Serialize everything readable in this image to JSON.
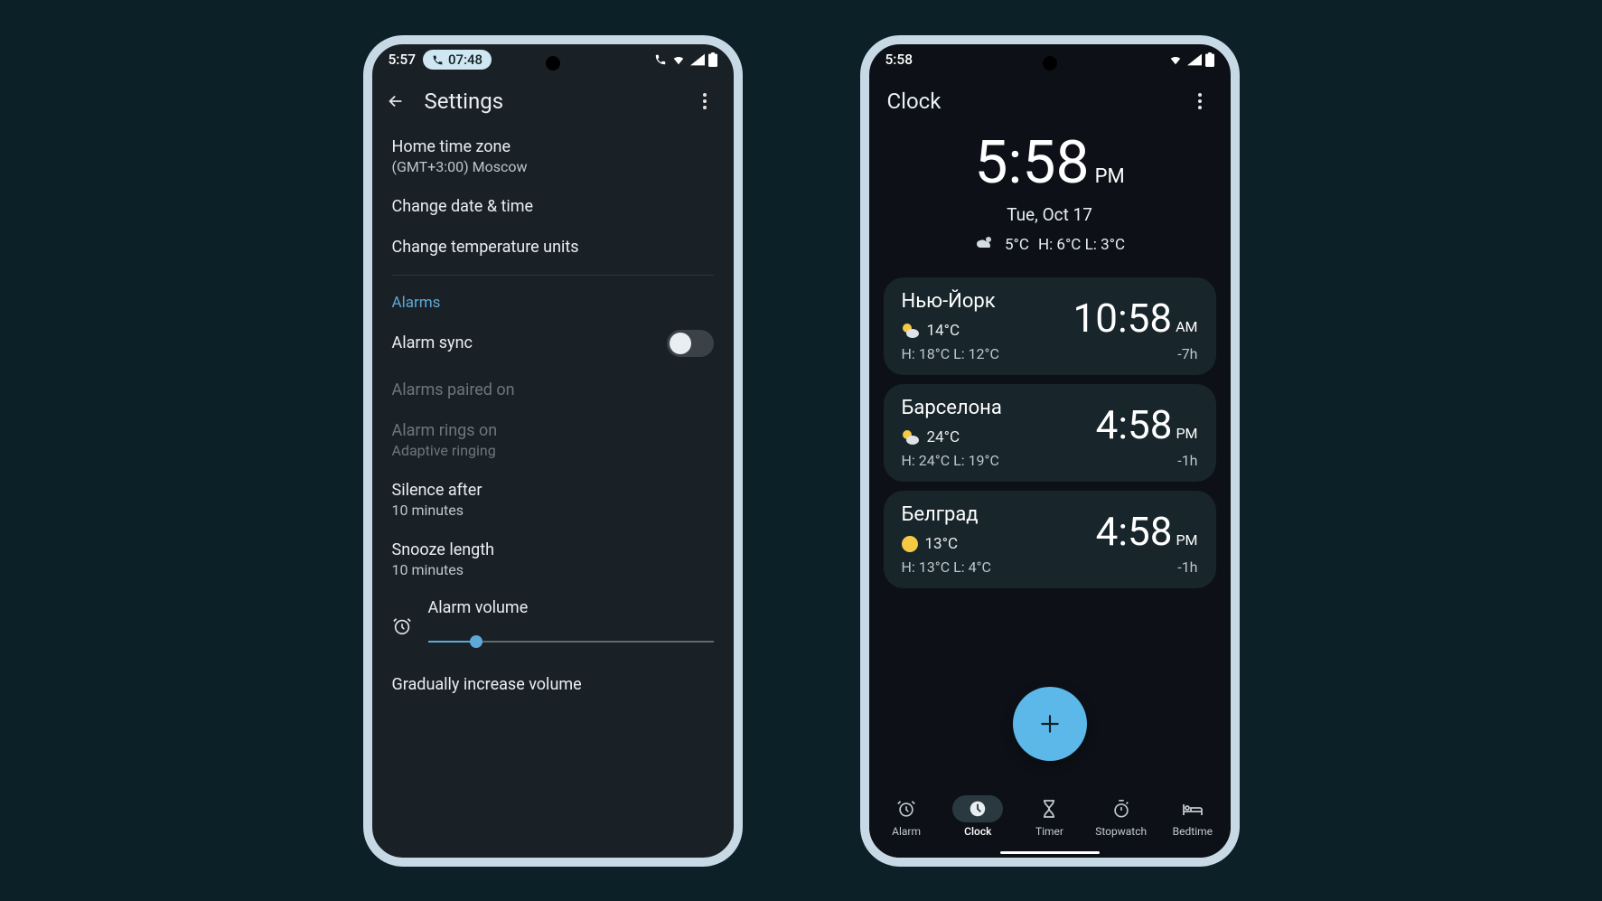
{
  "settings": {
    "status": {
      "time": "5:57",
      "call_pill": "07:48"
    },
    "title": "Settings",
    "home_tz": {
      "title": "Home time zone",
      "sub": "(GMT+3:00) Moscow"
    },
    "change_date": "Change date & time",
    "change_temp": "Change temperature units",
    "section_alarms": "Alarms",
    "alarm_sync": "Alarm sync",
    "alarms_paired": "Alarms paired on",
    "alarm_rings": {
      "title": "Alarm rings on",
      "sub": "Adaptive ringing"
    },
    "silence": {
      "title": "Silence after",
      "sub": "10 minutes"
    },
    "snooze": {
      "title": "Snooze length",
      "sub": "10 minutes"
    },
    "volume_label": "Alarm volume",
    "gradual": "Gradually increase volume"
  },
  "clock": {
    "status": {
      "time": "5:58"
    },
    "title": "Clock",
    "main_time": "5:58",
    "main_ampm": "PM",
    "date": "Tue, Oct 17",
    "temp": "5°C",
    "hl": "H: 6°C L: 3°C",
    "cities": [
      {
        "name": "Нью-Йорк",
        "temp": "14°C",
        "hl": "H: 18°C L: 12°C",
        "time": "10:58",
        "ampm": "AM",
        "offset": "-7h"
      },
      {
        "name": "Барселона",
        "temp": "24°C",
        "hl": "H: 24°C L: 19°C",
        "time": "4:58",
        "ampm": "PM",
        "offset": "-1h"
      },
      {
        "name": "Белград",
        "temp": "13°C",
        "hl": "H: 13°C L: 4°C",
        "time": "4:58",
        "ampm": "PM",
        "offset": "-1h"
      }
    ],
    "nav": {
      "alarm": "Alarm",
      "clock": "Clock",
      "timer": "Timer",
      "stopwatch": "Stopwatch",
      "bedtime": "Bedtime"
    }
  }
}
